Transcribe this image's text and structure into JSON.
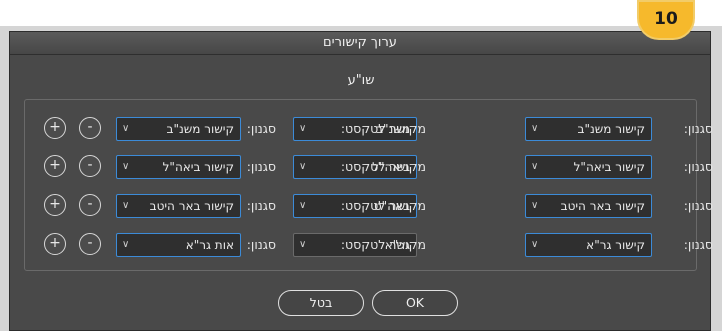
{
  "window": {
    "title": "ערוך קישורים"
  },
  "step_badge": "10",
  "section_title": "שו\"ע",
  "rows": [
    {
      "style_a_label": "סגנון:",
      "style_a_value": "קישור משנ\"ב",
      "text_label": "מקושר לטקסט:",
      "text_value": "משנ\"ב",
      "style_b_label": "סגנון:",
      "style_b_value": "קישור משנ\"ב"
    },
    {
      "style_a_label": "סגנון:",
      "style_a_value": "קישור ביאה\"ל",
      "text_label": "מקושר לטקסט:",
      "text_value": "ביאה\"ל",
      "style_b_label": "סגנון:",
      "style_b_value": "קישור ביאה\"ל"
    },
    {
      "style_a_label": "סגנון:",
      "style_a_value": "קישור באר היטב",
      "text_label": "מקושר לטקסט:",
      "text_value": "באה\"ט",
      "style_b_label": "סגנון:",
      "style_b_value": "קישור באר היטב"
    },
    {
      "style_a_label": "סגנון:",
      "style_a_value": "קישור גר\"א",
      "text_label": "מקושר לטקסט:",
      "text_value": "גר\"א",
      "style_b_label": "סגנון:",
      "style_b_value": "אות גר\"א"
    }
  ],
  "buttons": {
    "add": "+",
    "remove": "-",
    "cancel": "בטל",
    "ok": "OK"
  },
  "icons": {
    "dropdown": "chevron-down-icon"
  }
}
